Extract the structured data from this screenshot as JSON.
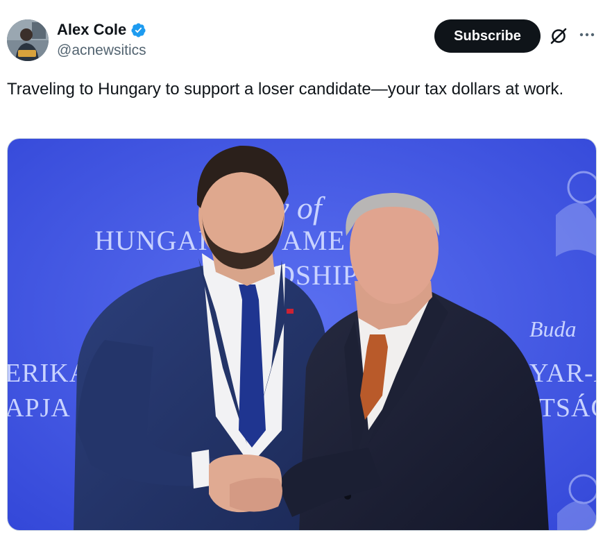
{
  "author": {
    "display_name": "Alex Cole",
    "handle": "@acnewsitics",
    "verified": true,
    "avatar_icon": "profile-photo"
  },
  "actions": {
    "subscribe_label": "Subscribe",
    "grok_icon": "grok-icon",
    "more_icon": "more-dots-icon"
  },
  "tweet": {
    "text": "Traveling to Hungary to support a loser candidate—your tax dollars at work."
  },
  "media": {
    "alt": "Two men in dark suits shaking hands in front of a blue backdrop",
    "backdrop_text": {
      "line1": "HUNGAI",
      "line1b": "AME",
      "line2": "DSHIP",
      "left1": "ERIKA",
      "left2": "APJA",
      "right1": "YAR-A",
      "right2": "ITSÁG",
      "script_top": "y of",
      "script_right": "Buda"
    }
  },
  "colors": {
    "verified_badge": "#1d9bf0",
    "backdrop_blue": "#3f58e6",
    "button_bg": "#0f1419"
  }
}
